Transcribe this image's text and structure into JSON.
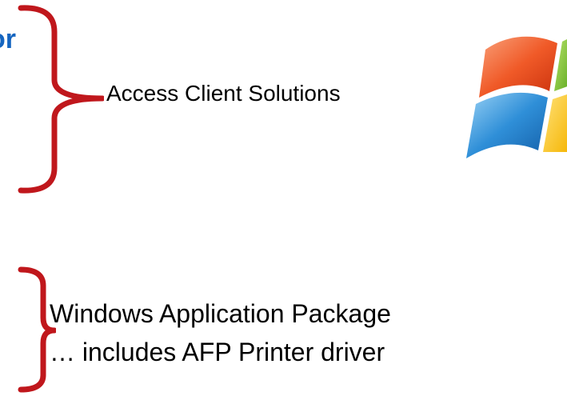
{
  "top": {
    "cut_text": "or",
    "label": "Access Client Solutions"
  },
  "bottom": {
    "line1": "Windows Application Package",
    "line2": "… includes AFP Printer driver"
  },
  "logo": {
    "icon": "windows-logo-icon"
  },
  "colors": {
    "bracket": "#c0171c",
    "cut_text": "#1565c0",
    "text": "#000000"
  }
}
